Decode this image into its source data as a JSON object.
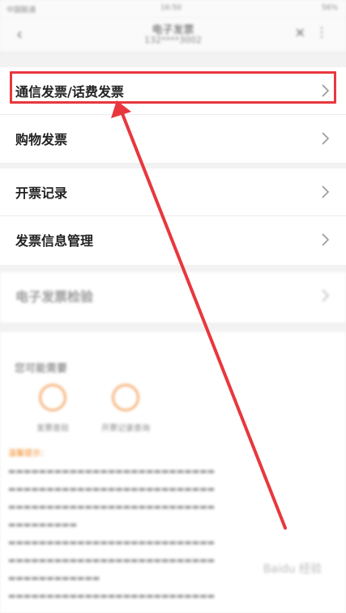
{
  "status": {
    "carrier": "中国联通",
    "time": "16:50",
    "battery": "56%"
  },
  "nav": {
    "back_icon": "chevron-left",
    "title": "电子发票",
    "subtitle": "132****3002",
    "close_icon": "close",
    "more_icon": "more-vertical"
  },
  "menu": {
    "group1": [
      {
        "label": "通信发票/话费发票"
      },
      {
        "label": "购物发票"
      }
    ],
    "group2": [
      {
        "label": "开票记录"
      },
      {
        "label": "发票信息管理"
      }
    ],
    "group3": [
      {
        "label": "电子发票检验"
      }
    ]
  },
  "bottom": {
    "heading": "您可能需要",
    "items": [
      {
        "label": "发票查验"
      },
      {
        "label": "开票记录查询"
      }
    ],
    "tip_title": "温馨提示：",
    "watermark": "Baidu 经验"
  },
  "colors": {
    "accent": "#e8373e",
    "orange": "#f08a24"
  }
}
